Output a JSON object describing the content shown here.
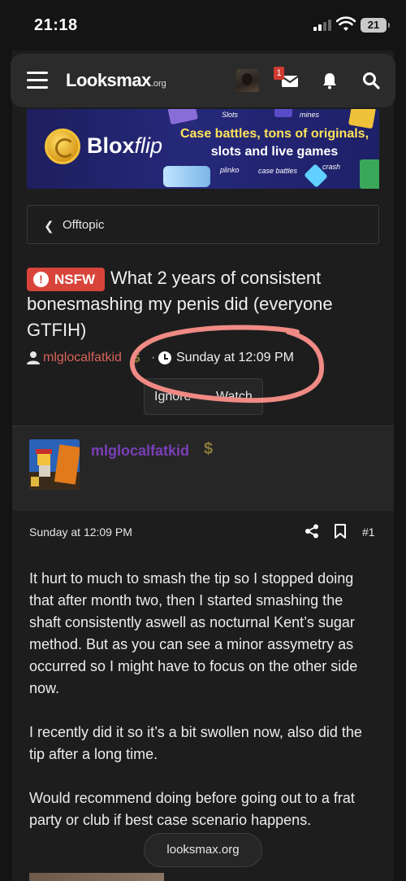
{
  "status_bar": {
    "time": "21:18",
    "battery": "21"
  },
  "header": {
    "logo_main": "Looksmax",
    "logo_suffix": ".org",
    "mail_badge": "1"
  },
  "banner": {
    "brand_first": "Blox",
    "brand_second": "flip",
    "tagline_line1": "Case battles, tons of originals,",
    "tagline_line2": "slots and live games",
    "labels": {
      "slots": "Slots",
      "mines": "mines",
      "plinko": "plinko",
      "case_battles": "case battles",
      "crash": "crash"
    }
  },
  "breadcrumb": {
    "label": "Offtopic"
  },
  "thread": {
    "prefix": "NSFW",
    "title": "What 2 years of consistent bonesmashing my penis did (everyone GTFIH)",
    "author": "mlglocalfatkid",
    "dollar": "$",
    "separator": "·",
    "date": "Sunday at 12:09 PM",
    "buttons": {
      "ignore": "Ignore",
      "watch": "Watch"
    }
  },
  "post": {
    "username": "mlglocalfatkid",
    "date": "Sunday at 12:09 PM",
    "number": "#1",
    "paragraphs": [
      "It hurt to much to smash the tip so I stopped doing that after month two, then I started smashing the shaft consistently aswell as nocturnal Kent’s sugar method. But as you can see a minor assymetry as occurred so I might have to focus on the other side now.",
      "I recently did it so it’s a bit swollen now, also did the tip after a long time.",
      "Would recommend doing before going out to a frat party or club if best case scenario happens."
    ]
  },
  "browser": {
    "domain": "looksmax.org"
  },
  "colors": {
    "nsfw_badge": "#d8443a",
    "author_link": "#d8645a",
    "post_user": "#7a3fb8",
    "annotation": "#f08a84"
  }
}
